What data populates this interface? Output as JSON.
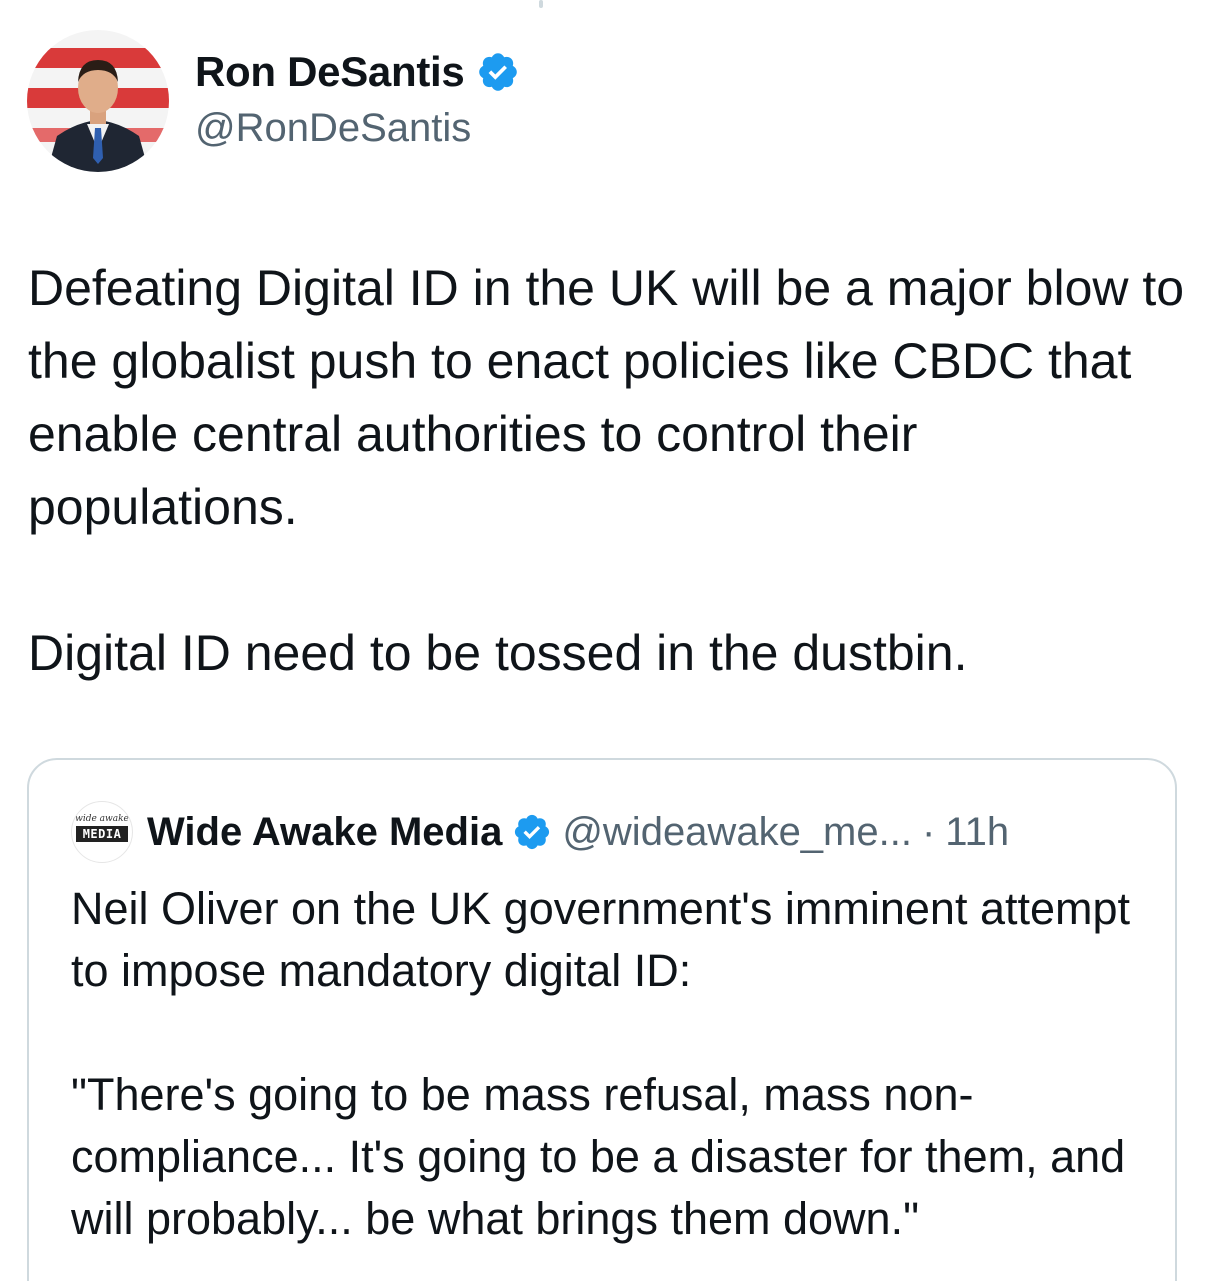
{
  "author": {
    "display_name": "Ron DeSantis",
    "handle": "@RonDeSantis",
    "verified": true,
    "avatar_icon": "profile-photo",
    "badge_color": "#1d9bf0"
  },
  "tweet": {
    "paragraphs": [
      "Defeating Digital ID in the UK will be a major blow to the globalist push to enact policies like CBDC that enable central authorities to control their populations.",
      "Digital ID need to be tossed in the dustbin."
    ]
  },
  "quoted_tweet": {
    "display_name": "Wide Awake Media",
    "handle": "@wideawake_me...",
    "separator": "·",
    "time": "11h",
    "verified": true,
    "avatar_logo_top": "wide awake",
    "avatar_logo_bar": "MEDIA",
    "paragraphs": [
      "Neil Oliver on the UK government's imminent attempt to impose mandatory digital ID:",
      "\"There's going to be mass refusal, mass non-compliance... It's going to be a disaster for them, and will probably... be what brings them down.\""
    ]
  },
  "colors": {
    "text_primary": "#0f1419",
    "text_secondary": "#536471",
    "border": "#cfd9de",
    "verified_blue": "#1d9bf0"
  }
}
